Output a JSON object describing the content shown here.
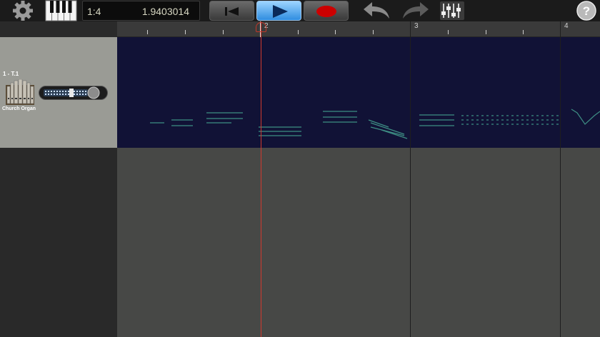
{
  "toolbar": {
    "position": "1:4",
    "time": "1.9403014",
    "help_label": "?"
  },
  "ruler": {
    "bars": [
      "2",
      "3",
      "4"
    ]
  },
  "track": {
    "name": "1 - T.1",
    "instrument": "Church Organ"
  },
  "playhead": {
    "bar": 2,
    "label": "playhead"
  },
  "colors": {
    "lane_bg": "#111236",
    "track_header_bg": "#9a9b95",
    "play_button": "#2f8de0",
    "record_button": "#cc0000",
    "playhead": "#d23a2e",
    "notes": "#3e8e84"
  },
  "icons": {
    "settings": "gear-icon",
    "keyboard": "piano-keys-icon",
    "rewind": "rewind-icon",
    "play": "play-icon",
    "record": "record-icon",
    "undo": "undo-icon",
    "redo": "redo-icon",
    "mixer": "mixer-icon",
    "help": "help-icon",
    "instrument": "organ-pipes-icon"
  }
}
